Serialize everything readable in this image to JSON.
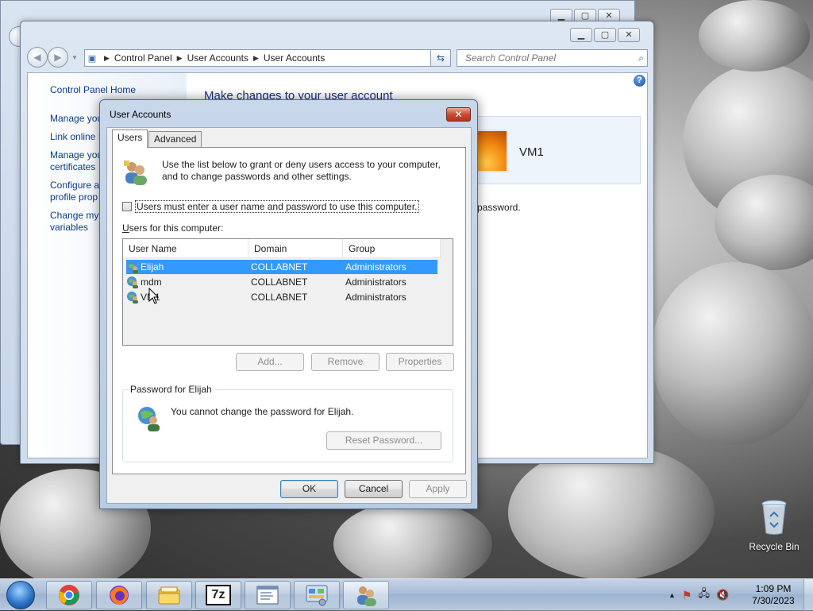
{
  "control_panel": {
    "breadcrumb": [
      "Control Panel",
      "User Accounts",
      "User Accounts"
    ],
    "search_placeholder": "Search Control Panel",
    "left_links": [
      "Control Panel Home",
      "Manage you",
      "Link online I",
      "Manage you",
      "certificates",
      "Configure a",
      "profile prop",
      "Change my",
      "variables"
    ],
    "main_title": "Make changes to your user account",
    "user_name": "VM1",
    "password_text": "password."
  },
  "dialog": {
    "title": "User Accounts",
    "tabs": [
      "Users",
      "Advanced"
    ],
    "intro_text": "Use the list below to grant or deny users access to your computer, and to change passwords and other settings.",
    "checkbox_label": "Users must enter a user name and password to use this computer.",
    "users_label_first": "U",
    "users_label_rest": "sers for this computer:",
    "columns": [
      "User Name",
      "Domain",
      "Group"
    ],
    "users": [
      {
        "name": "Elijah",
        "domain": "COLLABNET",
        "group": "Administrators"
      },
      {
        "name": "mdm",
        "domain": "COLLABNET",
        "group": "Administrators"
      },
      {
        "name": "VM1",
        "domain": "COLLABNET",
        "group": "Administrators"
      }
    ],
    "buttons": {
      "add": "Add...",
      "remove": "Remove",
      "properties": "Properties"
    },
    "password_group_title": "Password for Elijah",
    "password_message": "You cannot change the password for Elijah.",
    "reset_password": "Reset Password...",
    "ok": "OK",
    "cancel": "Cancel",
    "apply": "Apply"
  },
  "desktop": {
    "recycle_bin": "Recycle Bin"
  },
  "taskbar": {
    "apps": [
      "chrome-icon",
      "firefox-icon",
      "file-explorer-icon",
      "7zip-icon",
      "notepad-icon",
      "control-panel-icon",
      "user-accounts-icon"
    ],
    "seven_zip_label": "7z",
    "time": "1:09 PM",
    "date": "7/30/2023"
  }
}
